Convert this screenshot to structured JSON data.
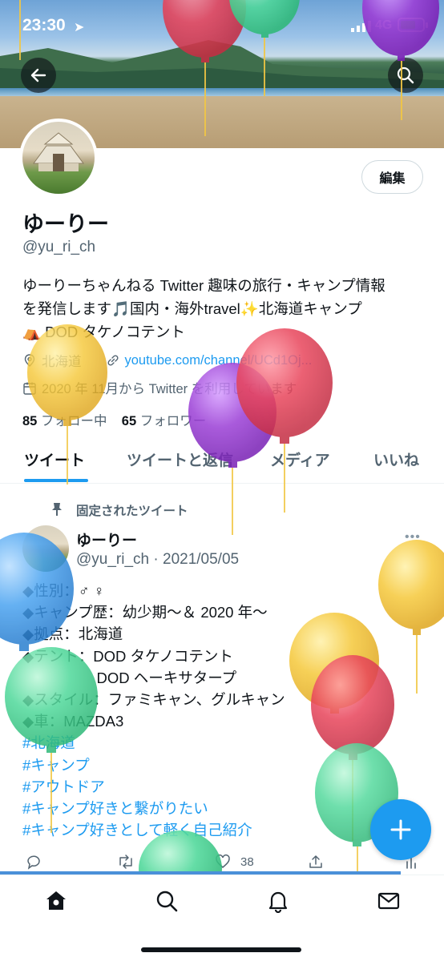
{
  "status_bar": {
    "time": "23:30",
    "network": "4G"
  },
  "profile": {
    "display_name": "ゆーりー",
    "handle": "@yu_ri_ch",
    "edit_label": "編集",
    "bio_lines": [
      "ゆーりーちゃんねる Twitter 趣味の旅行・キャンプ情報",
      "を発信します🎵国内・海外travel✨北海道キャンプ",
      "⛺ DOD タケノコテント"
    ],
    "location": "北海道",
    "link": "youtube.com/channel/UCd1Oj...",
    "joined": "2020 年 11月から Twitter を利用しています",
    "following_count": "85",
    "following_label": "フォロー中",
    "followers_count": "65",
    "followers_label": "フォロワー"
  },
  "tabs": [
    {
      "label": "ツイート",
      "active": true
    },
    {
      "label": "ツイートと返信",
      "active": false
    },
    {
      "label": "メディア",
      "active": false
    },
    {
      "label": "いいね",
      "active": false
    }
  ],
  "pinned_tweet": {
    "pinned_label": "固定されたツイート",
    "author_name": "ゆーりー",
    "author_handle": "@yu_ri_ch",
    "date": "2021/05/05",
    "lines": [
      "◆性別：♂ ♀",
      "◆キャンプ歴：幼少期〜＆ 2020 年〜",
      "◆拠点：北海道",
      "◆テント：DOD タケノコテント",
      "　　　　　DOD ヘーキサタープ",
      "◆スタイル：ファミキャン、グルキャン",
      "◆車：MAZDA3"
    ],
    "hashtags": [
      "#北海道",
      "#キャンプ",
      "#アウトドア",
      "#キャンプ好きと繋がりたい",
      "#キャンプ好きとして軽く自己紹介"
    ],
    "like_count": "38"
  },
  "colors": {
    "accent": "#1d9bf0",
    "balloon_yellow": "#f5c83a",
    "balloon_red": "#e8455b",
    "balloon_purple": "#9b3fd6",
    "balloon_green": "#4fd89a",
    "balloon_blue": "#4aa3f0"
  },
  "icons": [
    "back-arrow-icon",
    "search-icon",
    "location-pin-icon",
    "link-icon",
    "calendar-icon",
    "pin-icon",
    "reply-icon",
    "retweet-icon",
    "like-icon",
    "share-icon",
    "analytics-icon",
    "compose-plus-icon",
    "home-icon",
    "explore-icon",
    "notifications-icon",
    "messages-icon"
  ]
}
